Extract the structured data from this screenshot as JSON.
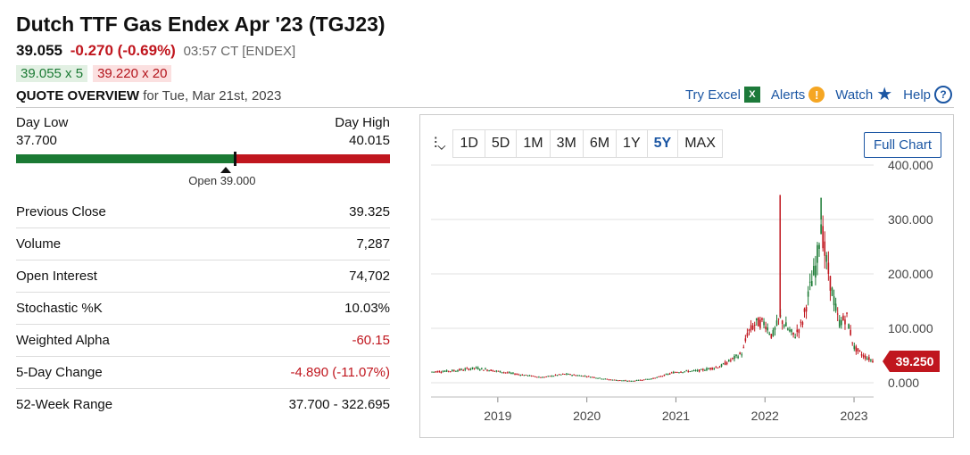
{
  "header": {
    "title": "Dutch TTF Gas Endex Apr '23 (TGJ23)",
    "last": "39.055",
    "change": "-0.270 (-0.69%)",
    "time": "03:57 CT [ENDEX]",
    "bid": "39.055 x 5",
    "ask": "39.220 x 20",
    "overview_label": "QUOTE OVERVIEW",
    "overview_date": "for Tue, Mar 21st, 2023"
  },
  "links": {
    "excel": "Try Excel",
    "alerts": "Alerts",
    "watch": "Watch",
    "help": "Help"
  },
  "range": {
    "low_label": "Day Low",
    "low_value": "37.700",
    "high_label": "Day High",
    "high_value": "40.015",
    "open_label": "Open 39.000",
    "low": 37.7,
    "high": 40.015,
    "open": 39.0,
    "last": 39.055
  },
  "stats": [
    {
      "label": "Previous Close",
      "value": "39.325",
      "neg": false
    },
    {
      "label": "Volume",
      "value": "7,287",
      "neg": false
    },
    {
      "label": "Open Interest",
      "value": "74,702",
      "neg": false
    },
    {
      "label": "Stochastic %K",
      "value": "10.03%",
      "neg": false
    },
    {
      "label": "Weighted Alpha",
      "value": "-60.15",
      "neg": true
    },
    {
      "label": "5-Day Change",
      "value": "-4.890 (-11.07%)",
      "neg": true
    },
    {
      "label": "52-Week Range",
      "value": "37.700 - 322.695",
      "neg": false
    }
  ],
  "chart": {
    "type_icon": "candlestick-icon",
    "ranges": [
      "1D",
      "5D",
      "1M",
      "3M",
      "6M",
      "1Y",
      "5Y",
      "MAX"
    ],
    "active_range": "5Y",
    "full_chart": "Full Chart",
    "current_label": "39.250"
  },
  "colors": {
    "up": "#1b7a34",
    "down": "#c0161e",
    "link": "#1b56a3"
  },
  "chart_data": {
    "type": "line",
    "x": [
      2018.25,
      2018.5,
      2018.75,
      2019.0,
      2019.25,
      2019.5,
      2019.75,
      2020.0,
      2020.25,
      2020.5,
      2020.75,
      2021.0,
      2021.25,
      2021.5,
      2021.75,
      2021.8,
      2021.9,
      2022.0,
      2022.08,
      2022.17,
      2022.25,
      2022.33,
      2022.42,
      2022.5,
      2022.58,
      2022.63,
      2022.67,
      2022.75,
      2022.83,
      2022.92,
      2023.0,
      2023.1,
      2023.22
    ],
    "series": [
      {
        "name": "",
        "values": [
          20,
          22,
          27,
          21,
          15,
          10,
          16,
          12,
          6,
          3,
          8,
          20,
          22,
          30,
          55,
          90,
          110,
          110,
          85,
          120,
          100,
          85,
          110,
          170,
          220,
          300,
          240,
          170,
          110,
          120,
          65,
          50,
          39.25
        ]
      }
    ],
    "peaks": [
      {
        "x": 2022.17,
        "y": 345
      },
      {
        "x": 2022.63,
        "y": 340
      }
    ],
    "xticks": [
      "2019",
      "2020",
      "2021",
      "2022",
      "2023"
    ],
    "yticks": [
      "400.000",
      "300.000",
      "200.000",
      "100.000",
      "0.000"
    ],
    "xlim": [
      2018.25,
      2023.22
    ],
    "ylim": [
      0,
      400
    ],
    "grid": true
  }
}
